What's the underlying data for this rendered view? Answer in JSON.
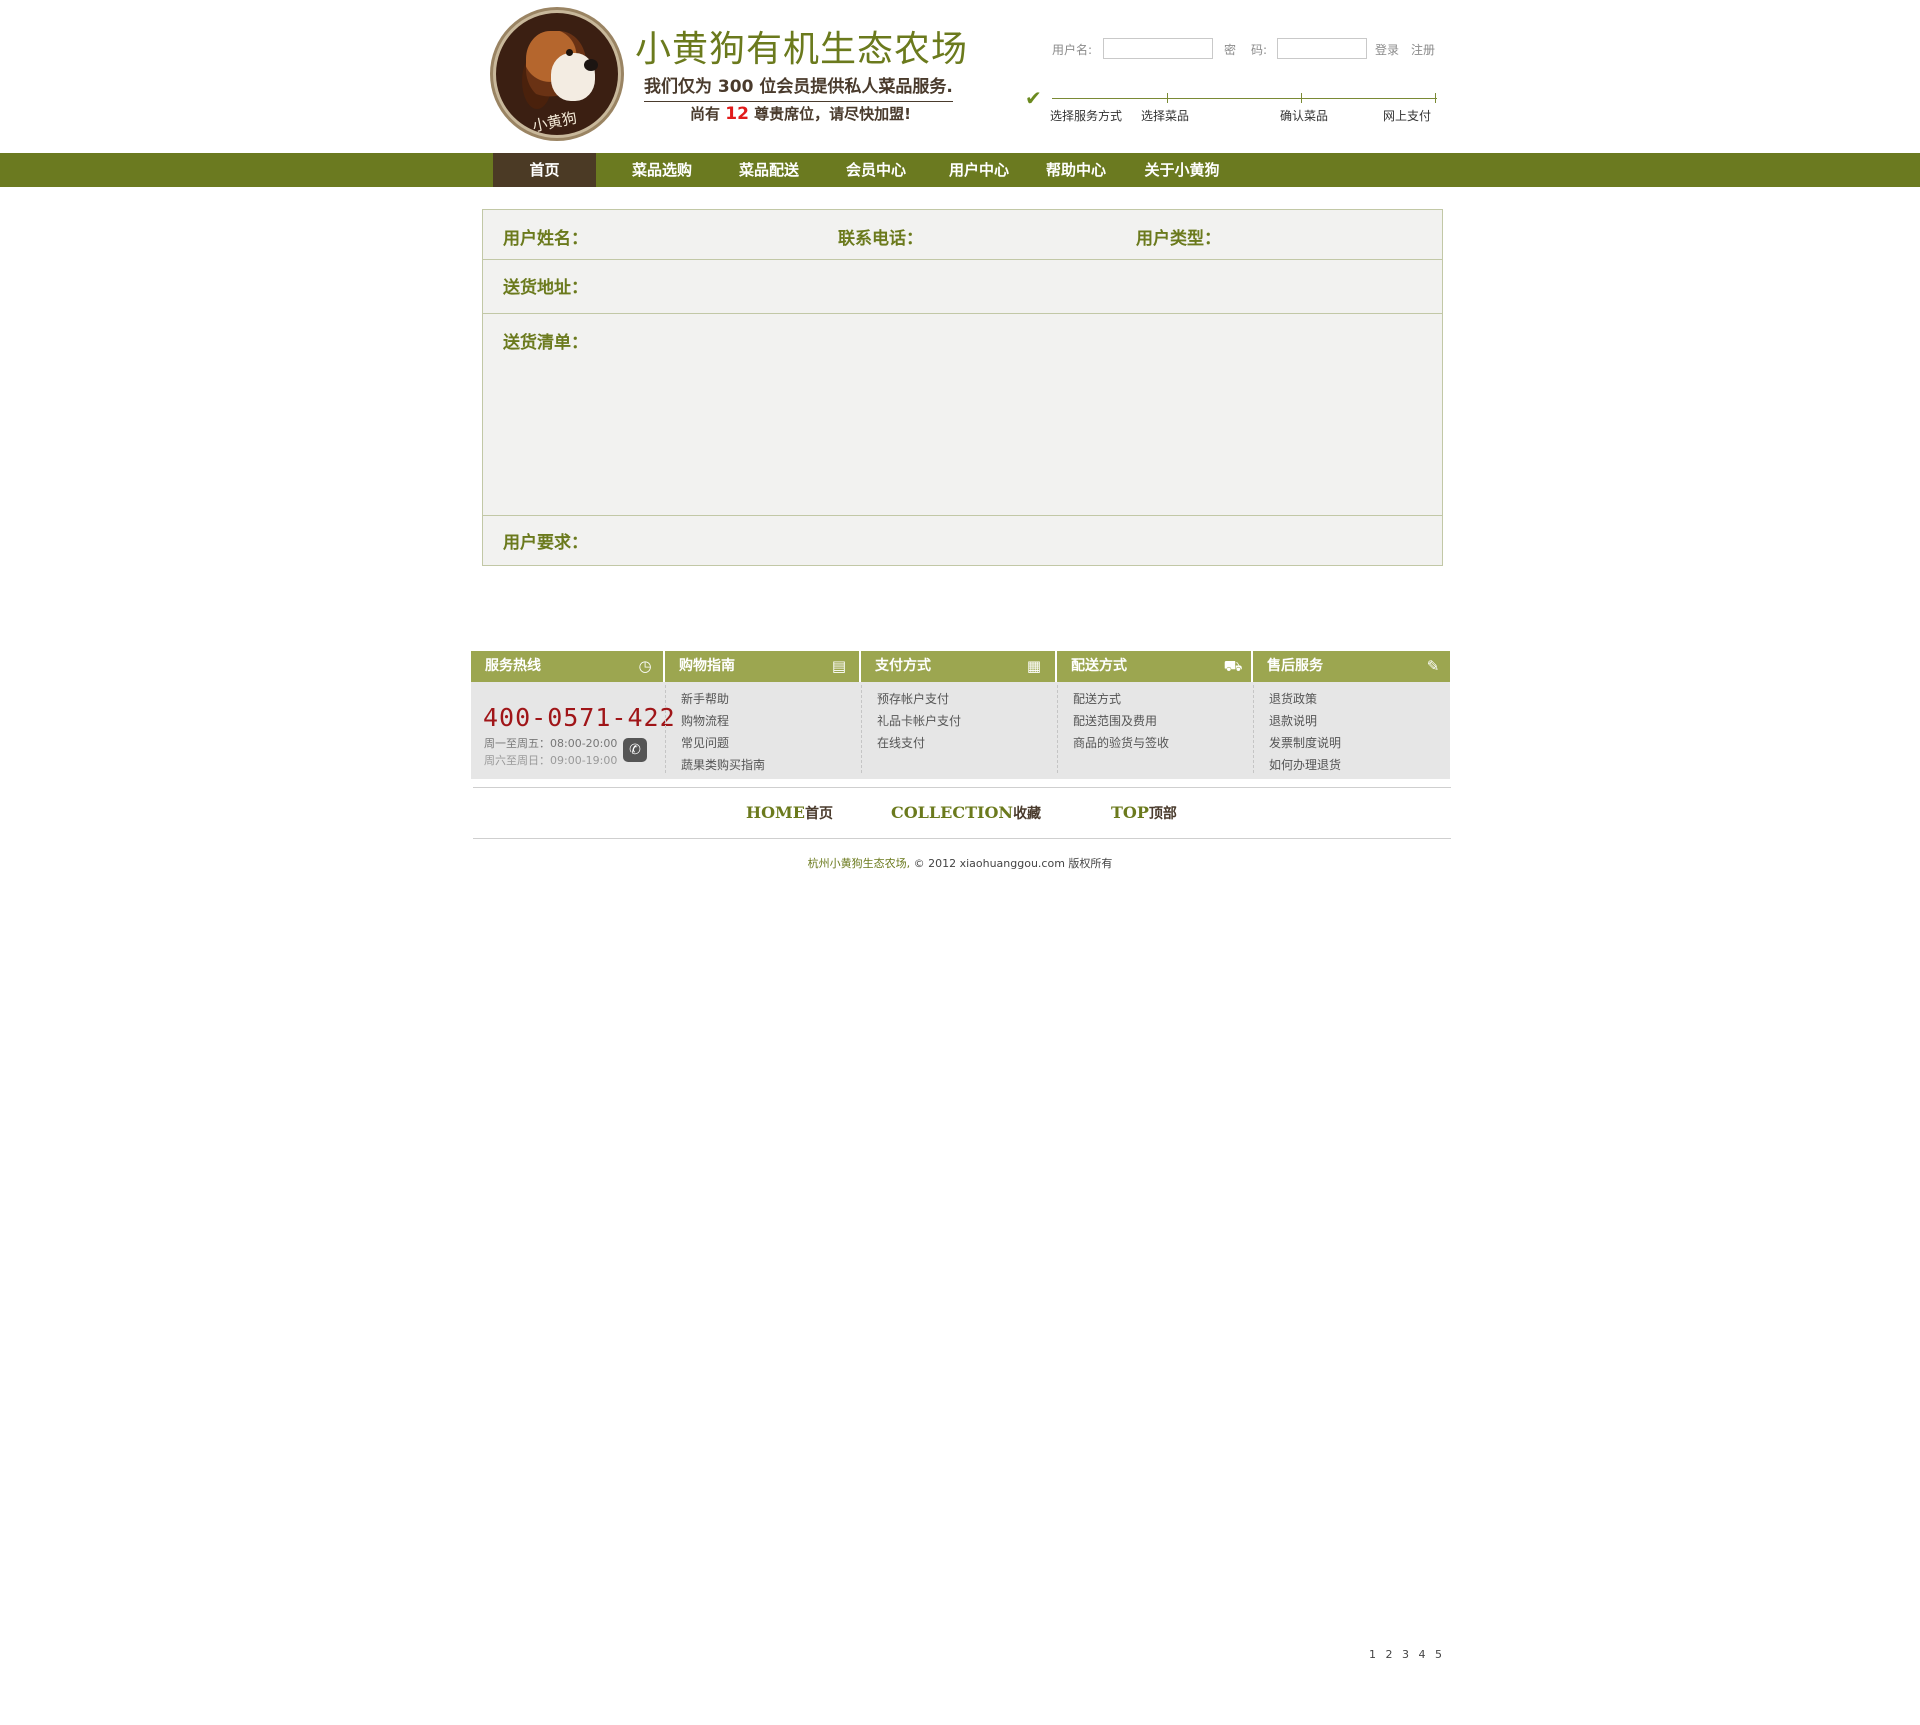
{
  "header": {
    "logo_badge": "小黄狗",
    "title": "小黄狗有机生态农场",
    "slogan": "我们仅为 300 位会员提供私人菜品服务.",
    "slogan2_prefix": "尚有",
    "slogan2_seats": "12",
    "slogan2_suffix": "尊贵席位，请尽快加盟!"
  },
  "login": {
    "username_label": "用户名:",
    "password_label_a": "密",
    "password_label_b": "码:",
    "login_link": "登录",
    "register_link": "注册"
  },
  "steps": [
    "选择服务方式",
    "选择菜品",
    "确认菜品",
    "网上支付"
  ],
  "nav": {
    "items": [
      "首页",
      "菜品选购",
      "菜品配送",
      "会员中心",
      "用户中心",
      "帮助中心",
      "关于小黄狗"
    ],
    "active_index": 0
  },
  "form": {
    "user_name_label": "用户姓名：",
    "phone_label": "联系电话：",
    "user_type_label": "用户类型：",
    "address_label": "送货地址：",
    "list_label": "送货清单：",
    "requirement_label": "用户要求："
  },
  "service": {
    "hotline": {
      "title": "服务热线",
      "number": "400-0571-422",
      "hours_weekday": "周一至周五：08:00-20:00",
      "hours_weekend": "周六至周日：09:00-19:00"
    },
    "columns": [
      {
        "title": "购物指南",
        "links": [
          "新手帮助",
          "购物流程",
          "常见问题",
          "蔬果类购买指南"
        ]
      },
      {
        "title": "支付方式",
        "links": [
          "预存帐户支付",
          "礼品卡帐户支付",
          "在线支付"
        ]
      },
      {
        "title": "配送方式",
        "links": [
          "配送方式",
          "配送范围及费用",
          "商品的验货与签收"
        ]
      },
      {
        "title": "售后服务",
        "links": [
          "退货政策",
          "退款说明",
          "发票制度说明",
          "如何办理退货"
        ]
      }
    ]
  },
  "bottom_nav": [
    {
      "en": "HOME",
      "zh": "首页"
    },
    {
      "en": "COLLECTION",
      "zh": "收藏"
    },
    {
      "en": "TOP",
      "zh": "顶部"
    }
  ],
  "copyright": {
    "brand": "杭州小黄狗生态农场,",
    "rest": "© 2012 xiaohuanggou.com 版权所有"
  },
  "pager": [
    "1",
    "2",
    "3",
    "4",
    "5"
  ],
  "colors": {
    "brand_green": "#6b7a20",
    "nav_active": "#4b3a25",
    "service_header": "#9ca650",
    "hotline_red": "#a01518",
    "seats_red": "#e11b1b"
  }
}
